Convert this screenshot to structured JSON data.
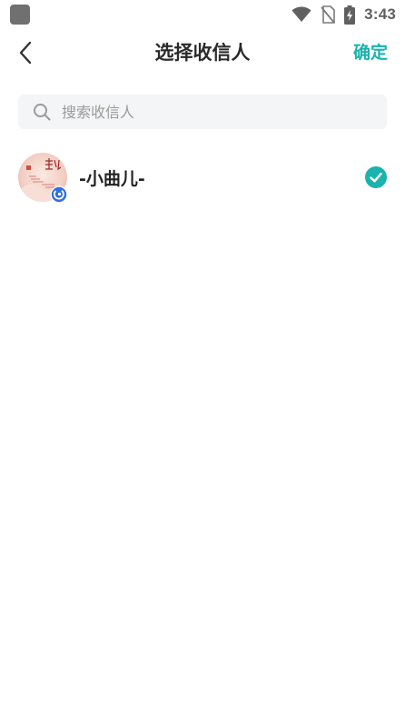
{
  "status_bar": {
    "time": "3:43",
    "icons": [
      "wifi-icon",
      "no-sim-icon",
      "battery-charging-icon"
    ]
  },
  "header": {
    "title": "选择收信人",
    "confirm_label": "确定",
    "back_icon": "chevron-left-icon"
  },
  "search": {
    "placeholder": "搜索收信人",
    "value": "",
    "icon": "search-icon"
  },
  "contacts": [
    {
      "name": "-小曲儿-",
      "avatar_text": "曲儿",
      "verified": true,
      "selected": true
    }
  ],
  "colors": {
    "accent": "#1bb3ad",
    "search_bg": "#f4f5f6",
    "badge_blue": "#2f6fe0"
  }
}
